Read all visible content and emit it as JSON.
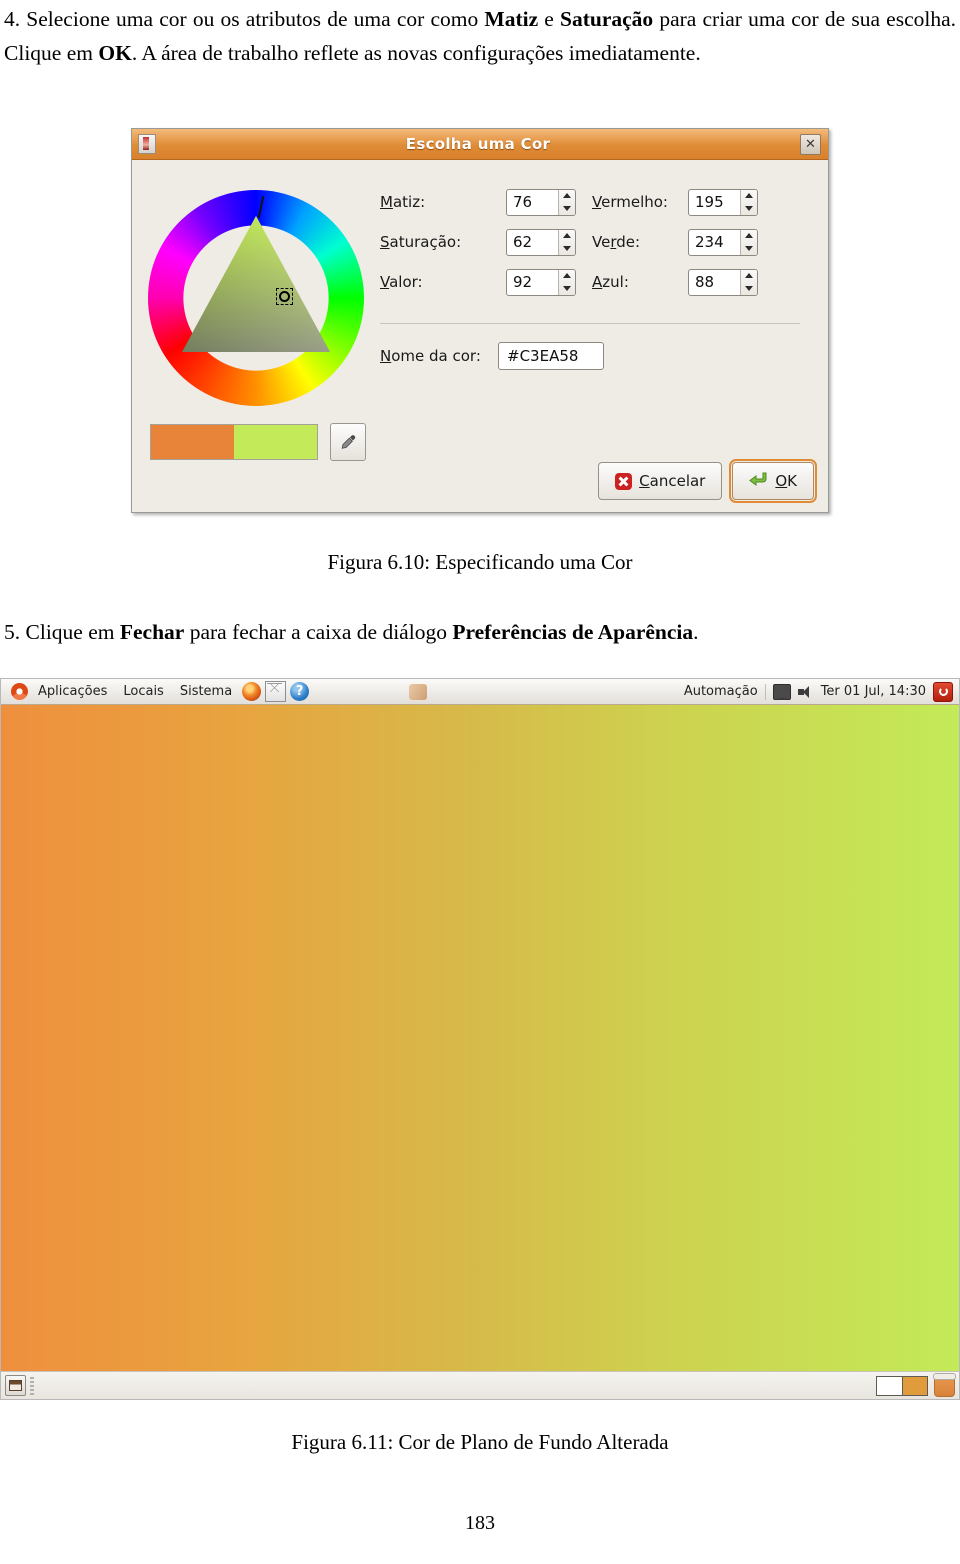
{
  "document": {
    "paragraph_4": {
      "number": "4.",
      "text_part_1": " Selecione uma cor ou os atributos de uma cor como ",
      "bold_1": "Matiz",
      "text_part_2": " e ",
      "bold_2": "Saturação",
      "text_part_3": " para criar uma cor de sua escolha. Clique em ",
      "bold_3": "OK",
      "text_part_4": ". A área de trabalho reflete as novas configurações imediatamente."
    },
    "paragraph_5": {
      "number": "5.",
      "text_part_1": " Clique em ",
      "bold_1": "Fechar",
      "text_part_2": " para fechar a caixa de diálogo ",
      "bold_2": "Preferências de Aparência",
      "text_part_3": "."
    },
    "figure_610_caption": "Figura 6.10: Especificando uma Cor",
    "figure_611_caption": "Figura 6.11: Cor de Plano de Fundo Alterada",
    "page_number": "183"
  },
  "color_dialog": {
    "title": "Escolha uma Cor",
    "close_label": "✕",
    "fields": [
      {
        "label": "Matiz:",
        "mnemonic": "M",
        "value": "76"
      },
      {
        "label": "Saturação:",
        "mnemonic": "S",
        "value": "62"
      },
      {
        "label": "Valor:",
        "mnemonic": "V",
        "value": "92"
      }
    ],
    "rgb_fields": [
      {
        "label": "Vermelho:",
        "mnemonic": "V",
        "value": "195"
      },
      {
        "label": "Verde:",
        "mnemonic": "r",
        "value": "234"
      },
      {
        "label": "Azul:",
        "mnemonic": "A",
        "value": "88"
      }
    ],
    "color_name": {
      "label": "Nome da cor:",
      "value": "#C3EA58"
    },
    "swatches": {
      "old_color": "#E8833A",
      "new_color": "#C3EA58"
    },
    "buttons": {
      "cancel": "Cancelar",
      "ok": "OK"
    },
    "selected_color": "#C3EA58"
  },
  "desktop": {
    "top_panel": {
      "menus": [
        "Aplicações",
        "Locais",
        "Sistema"
      ],
      "launchers": [
        "firefox-icon",
        "mail-icon",
        "help-icon"
      ],
      "automation_label": "Automação",
      "clock": "Ter 01 Jul, 14:30"
    },
    "background": {
      "gradient_start": "#EF8F3E",
      "gradient_end": "#C3EA58"
    },
    "bottom_panel": {
      "workspaces": 2,
      "active_workspace": 1
    }
  }
}
